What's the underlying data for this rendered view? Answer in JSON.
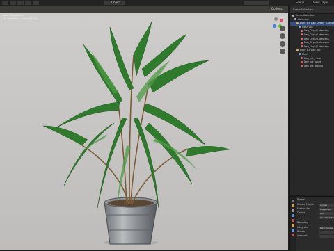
{
  "topbar": {
    "menus": [
      "",
      "",
      "",
      "",
      "",
      ""
    ],
    "mode_label": "Object",
    "view_layer": "Scene",
    "view_layer2": "View Layer",
    "options_label": "Options"
  },
  "viewport": {
    "overlay_lines": [
      "User Perspective",
      "(1) Collection | chrys_P3_Dag"
    ],
    "background": "#cbc9c7"
  },
  "outliner": {
    "title": "Scene Collection",
    "rows": [
      {
        "label": "Scene Collection",
        "indent": 0,
        "icon": "collection-icon",
        "color": "#b0b0b0",
        "selected": false
      },
      {
        "label": "Collection",
        "indent": 1,
        "icon": "collection-icon",
        "color": "#b0b0b0",
        "selected": false
      },
      {
        "label": "plant_P3_Dag_Dypsis_Lutescens",
        "indent": 2,
        "icon": "object-icon",
        "color": "#e8a75a",
        "selected": true
      },
      {
        "label": "Mesh.001",
        "indent": 3,
        "icon": "mesh-icon",
        "color": "#7fb0e0",
        "selected": false
      },
      {
        "label": "Dag_Dypsi_Lutescens",
        "indent": 4,
        "icon": "material-icon",
        "color": "#d26a6a",
        "selected": false
      },
      {
        "label": "Dag_Dypsi_Lutescens",
        "indent": 4,
        "icon": "material-icon",
        "color": "#d26a6a",
        "selected": false
      },
      {
        "label": "Dag_Dypsi_Lutescens",
        "indent": 4,
        "icon": "material-icon",
        "color": "#d26a6a",
        "selected": false
      },
      {
        "label": "Dag_Dypsi_Lutescens",
        "indent": 4,
        "icon": "material-icon",
        "color": "#d26a6a",
        "selected": false
      },
      {
        "label": "Dag_Dypsi_Lutescens",
        "indent": 4,
        "icon": "material-icon",
        "color": "#d26a6a",
        "selected": false
      },
      {
        "label": "plant_P3_Dag_pot",
        "indent": 2,
        "icon": "object-icon",
        "color": "#e8a75a",
        "selected": false
      },
      {
        "label": "Mesh",
        "indent": 3,
        "icon": "mesh-icon",
        "color": "#7fb0e0",
        "selected": false
      },
      {
        "label": "Dag_pot_metal",
        "indent": 4,
        "icon": "material-icon",
        "color": "#d26a6a",
        "selected": false
      },
      {
        "label": "Dag_pot_wood",
        "indent": 4,
        "icon": "material-icon",
        "color": "#d26a6a",
        "selected": false
      },
      {
        "label": "Dag_pot_ground",
        "indent": 4,
        "icon": "material-icon",
        "color": "#d26a6a",
        "selected": false
      }
    ]
  },
  "properties": {
    "section": "Scene",
    "rows": [
      {
        "label": "Render Engine",
        "value": "Cycles"
      },
      {
        "label": "Feature Set",
        "value": "Supported"
      },
      {
        "label": "Device",
        "value": "GPU"
      },
      {
        "label": "",
        "value": "Open Shading"
      }
    ],
    "sampling_section": "Sampling",
    "sampling_rows": [
      {
        "label": "Integrator",
        "value": "Path Tracing"
      },
      {
        "label": "Render",
        "value": ""
      },
      {
        "label": "Viewport",
        "value": ""
      }
    ]
  }
}
